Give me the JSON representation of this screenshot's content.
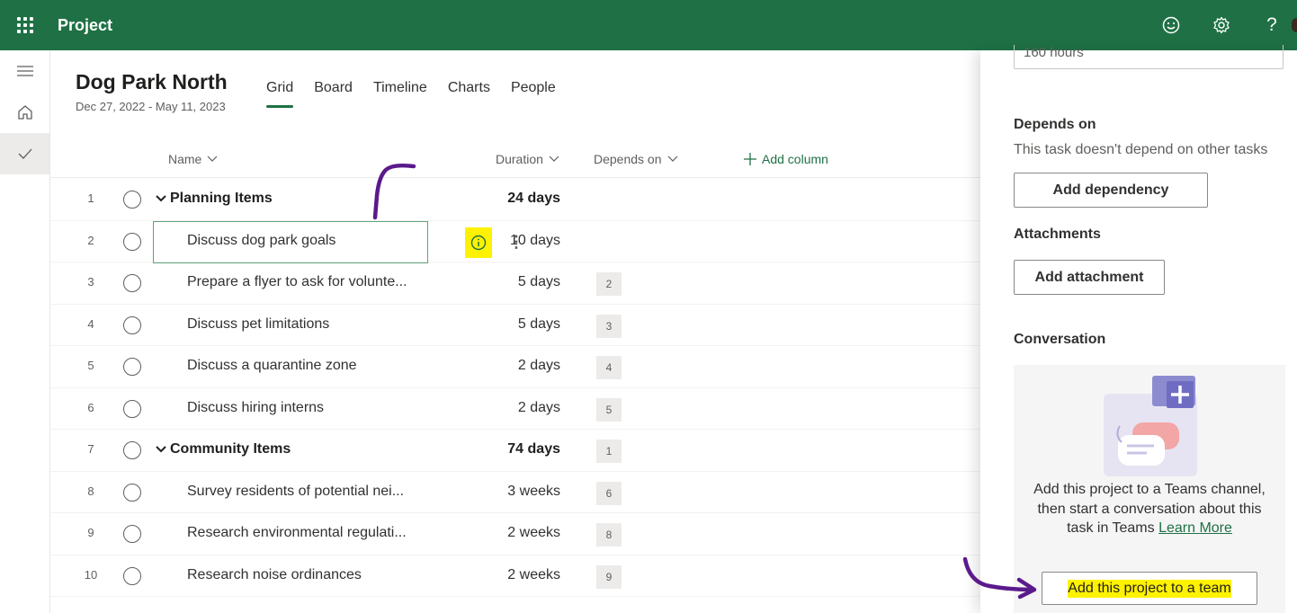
{
  "topbar": {
    "app_title": "Project",
    "icons": [
      "app-launcher-icon",
      "smiley-feedback-icon",
      "settings-gear-icon",
      "help-icon"
    ],
    "brand_color": "#1f7145"
  },
  "leftrail": {
    "items": [
      "menu-icon",
      "home-icon",
      "checkmark-icon"
    ]
  },
  "header": {
    "project_title": "Dog Park North",
    "date_range": "Dec 27, 2022 - May 11, 2023",
    "tabs": [
      {
        "label": "Grid",
        "active": true
      },
      {
        "label": "Board",
        "active": false
      },
      {
        "label": "Timeline",
        "active": false
      },
      {
        "label": "Charts",
        "active": false
      },
      {
        "label": "People",
        "active": false
      }
    ]
  },
  "grid": {
    "columns": {
      "name": "Name",
      "duration": "Duration",
      "depends_on": "Depends on",
      "add_column": "Add column"
    },
    "rows": [
      {
        "num": "1",
        "name": "Planning Items",
        "duration": "24 days",
        "depends": "",
        "group": true
      },
      {
        "num": "2",
        "name": "Discuss dog park goals",
        "duration": "10 days",
        "depends": "",
        "group": false,
        "selected": true
      },
      {
        "num": "3",
        "name": "Prepare a flyer to ask for volunte...",
        "duration": "5 days",
        "depends": "2",
        "group": false
      },
      {
        "num": "4",
        "name": "Discuss pet limitations",
        "duration": "5 days",
        "depends": "3",
        "group": false
      },
      {
        "num": "5",
        "name": "Discuss a quarantine zone",
        "duration": "2 days",
        "depends": "4",
        "group": false
      },
      {
        "num": "6",
        "name": "Discuss hiring interns",
        "duration": "2 days",
        "depends": "5",
        "group": false
      },
      {
        "num": "7",
        "name": "Community Items",
        "duration": "74 days",
        "depends": "1",
        "group": true
      },
      {
        "num": "8",
        "name": "Survey residents of potential nei...",
        "duration": "3 weeks",
        "depends": "6",
        "group": false
      },
      {
        "num": "9",
        "name": "Research environmental regulati...",
        "duration": "2 weeks",
        "depends": "8",
        "group": false
      },
      {
        "num": "10",
        "name": "Research noise ordinances",
        "duration": "2 weeks",
        "depends": "9",
        "group": false
      }
    ]
  },
  "panel": {
    "effort_value": "160 hours",
    "depends_title": "Depends on",
    "depends_text": "This task doesn't depend on other tasks",
    "add_dependency": "Add dependency",
    "attachments_title": "Attachments",
    "add_attachment": "Add attachment",
    "conversation_title": "Conversation",
    "conversation_text": "Add this project to a Teams channel, then start a conversation about this task in Teams",
    "learn_more": "Learn More",
    "add_team_button": "Add this project to a team"
  },
  "annotations": {
    "highlight_color": "#fff200",
    "ink_color": "#5b1a8c"
  }
}
